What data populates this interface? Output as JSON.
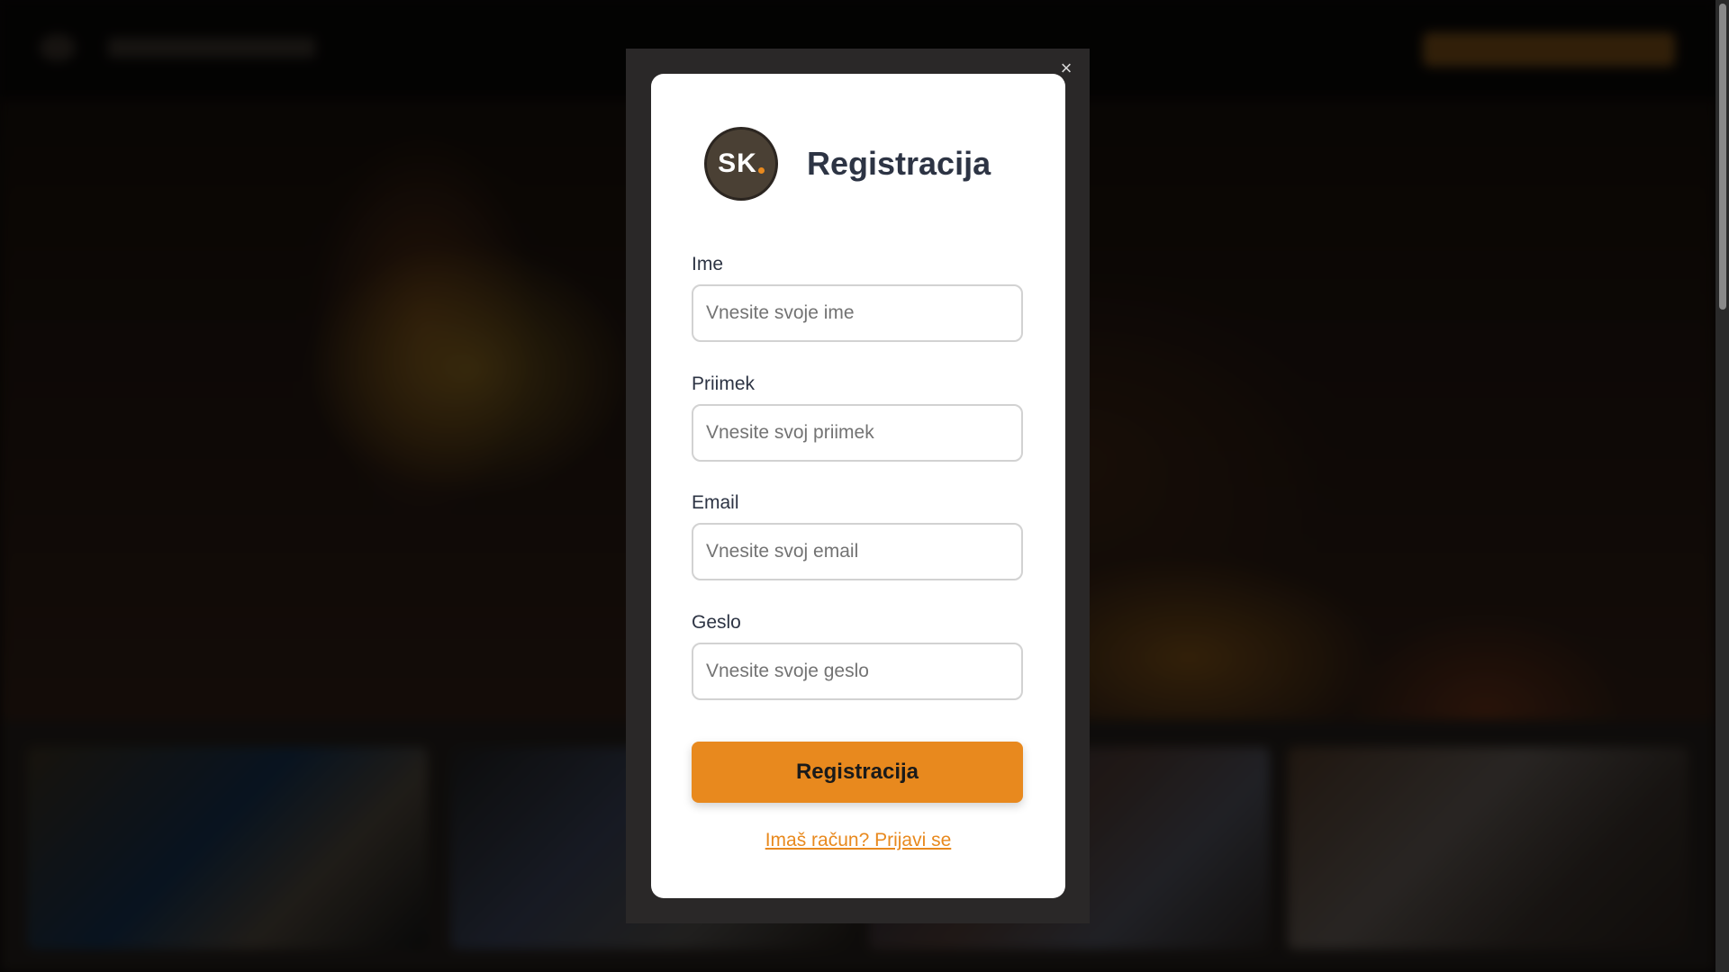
{
  "modal": {
    "close_symbol": "×",
    "brand": {
      "text": "SK",
      "accent_color": "#e8891e",
      "icon": "sk-logo-icon"
    },
    "title": "Registracija",
    "fields": [
      {
        "label": "Ime",
        "placeholder": "Vnesite svoje ime",
        "value": ""
      },
      {
        "label": "Priimek",
        "placeholder": "Vnesite svoj priimek",
        "value": ""
      },
      {
        "label": "Email",
        "placeholder": "Vnesite svoj email",
        "value": ""
      },
      {
        "label": "Geslo",
        "placeholder": "Vnesite svoje geslo",
        "value": ""
      }
    ],
    "submit_label": "Registracija",
    "login_link": "Imaš račun? Prijavi se"
  },
  "colors": {
    "accent": "#e8891e",
    "title_text": "#2d3444",
    "modal_bg": "#ffffff",
    "overlay_frame": "#2a2828"
  }
}
